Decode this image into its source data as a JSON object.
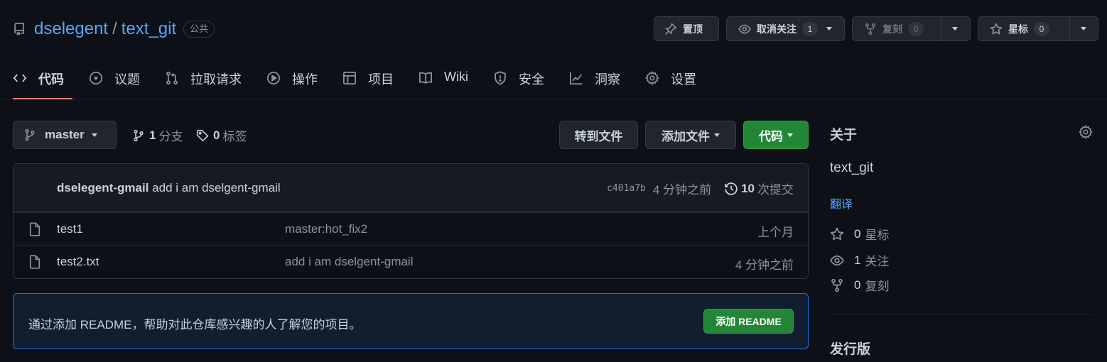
{
  "repo": {
    "owner": "dselegent",
    "separator": "/",
    "name": "text_git",
    "visibility": "公共"
  },
  "actions": {
    "pin_label": "置顶",
    "watch_label": "取消关注",
    "watch_count": "1",
    "fork_label": "复刻",
    "fork_count": "0",
    "star_label": "星标",
    "star_count": "0"
  },
  "tabs": [
    {
      "label": "代码",
      "icon": "code-icon",
      "active": true
    },
    {
      "label": "议题",
      "icon": "issue-icon"
    },
    {
      "label": "拉取请求",
      "icon": "pull-request-icon"
    },
    {
      "label": "操作",
      "icon": "play-icon"
    },
    {
      "label": "项目",
      "icon": "table-icon"
    },
    {
      "label": "Wiki",
      "icon": "book-icon"
    },
    {
      "label": "安全",
      "icon": "shield-icon"
    },
    {
      "label": "洞察",
      "icon": "graph-icon"
    },
    {
      "label": "设置",
      "icon": "gear-icon"
    }
  ],
  "toolbar": {
    "branch": "master",
    "branch_count": "1",
    "branch_label": "分支",
    "tag_count": "0",
    "tag_label": "标签",
    "goto_file": "转到文件",
    "add_file": "添加文件",
    "code": "代码"
  },
  "commit": {
    "author": "dselegent-gmail",
    "message": "add i am dselgent-gmail",
    "sha": "c401a7b",
    "age": "4 分钟之前",
    "commit_count": "10",
    "commit_label": "次提交"
  },
  "files": [
    {
      "name": "test1",
      "message": "master:hot_fix2",
      "age": "上个月"
    },
    {
      "name": "test2.txt",
      "message": "add i am dselgent-gmail",
      "age": "4 分钟之前"
    }
  ],
  "readme": {
    "text": "通过添加 README，帮助对此仓库感兴趣的人了解您的项目。",
    "button": "添加 README"
  },
  "sidebar": {
    "about_title": "关于",
    "description": "text_git",
    "translate": "翻译",
    "stars_count": "0",
    "stars_label": "星标",
    "watchers_count": "1",
    "watchers_label": "关注",
    "forks_count": "0",
    "forks_label": "复刻",
    "releases_title": "发行版"
  },
  "colors": {
    "background": "#0d1117",
    "link": "#58a6ff",
    "green_button": "#238636",
    "tab_underline": "#f78166"
  }
}
